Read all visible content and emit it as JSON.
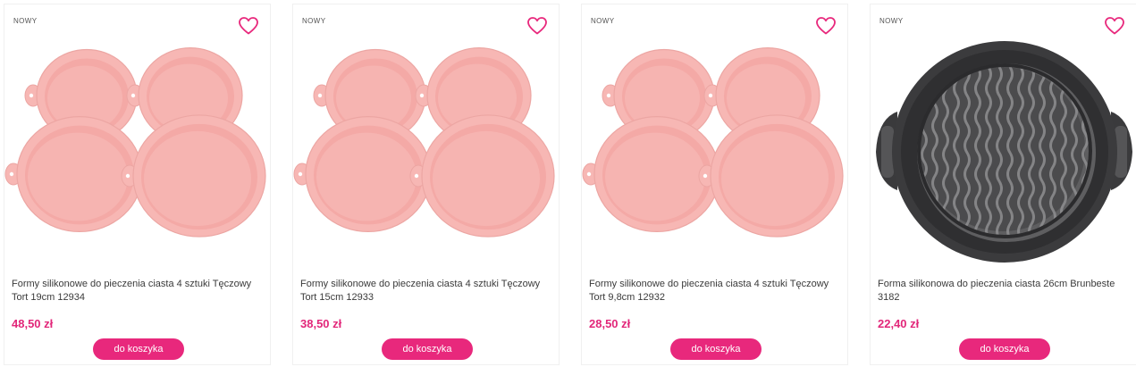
{
  "theme": {
    "accent": "#e8287c",
    "price_color": "#e2277a",
    "mold_pink": "#f7b7b4",
    "mold_gray": "#3c3c3e"
  },
  "products": [
    {
      "badge": "NOWY",
      "wishlist_icon": "heart-outline-icon",
      "title": "Formy silikonowe do pieczenia ciasta 4 sztuki Tęczowy Tort 19cm 12934",
      "price": "48,50 zł",
      "button": "do koszyka"
    },
    {
      "badge": "NOWY",
      "wishlist_icon": "heart-outline-icon",
      "title": "Formy silikonowe do pieczenia ciasta 4 sztuki Tęczowy Tort 15cm 12933",
      "price": "38,50 zł",
      "button": "do koszyka"
    },
    {
      "badge": "NOWY",
      "wishlist_icon": "heart-outline-icon",
      "title": "Formy silikonowe do pieczenia ciasta 4 sztuki Tęczowy Tort 9,8cm 12932",
      "price": "28,50 zł",
      "button": "do koszyka"
    },
    {
      "badge": "NOWY",
      "wishlist_icon": "heart-outline-icon",
      "title": "Forma silikonowa do pieczenia ciasta 26cm Brunbeste 3182",
      "price": "22,40 zł",
      "button": "do koszyka"
    }
  ]
}
